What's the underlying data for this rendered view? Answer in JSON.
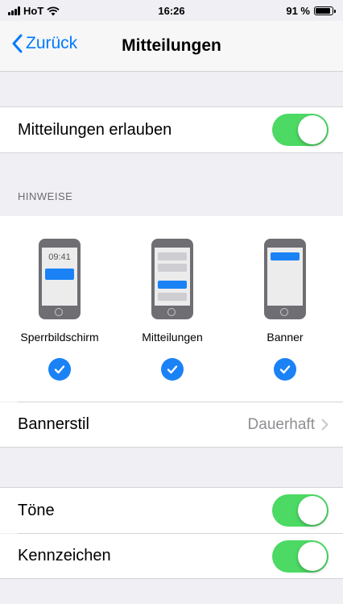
{
  "status_bar": {
    "carrier": "HoT",
    "time": "16:26",
    "battery_percent": "91 %",
    "battery_level": 0.91
  },
  "nav": {
    "back_label": "Zurück",
    "title": "Mitteilungen"
  },
  "allow": {
    "label": "Mitteilungen erlauben",
    "enabled": true
  },
  "hints": {
    "header": "HINWEISE",
    "options": [
      {
        "label": "Sperrbildschirm",
        "clock": "09:41",
        "checked": true
      },
      {
        "label": "Mitteilungen",
        "checked": true
      },
      {
        "label": "Banner",
        "checked": true
      }
    ]
  },
  "banner_style": {
    "label": "Bannerstil",
    "value": "Dauerhaft"
  },
  "sounds": {
    "label": "Töne",
    "enabled": true
  },
  "badges": {
    "label": "Kennzeichen",
    "enabled": true
  },
  "colors": {
    "accent": "#007aff",
    "toggle_on": "#4cd964",
    "check": "#1a82f5"
  }
}
